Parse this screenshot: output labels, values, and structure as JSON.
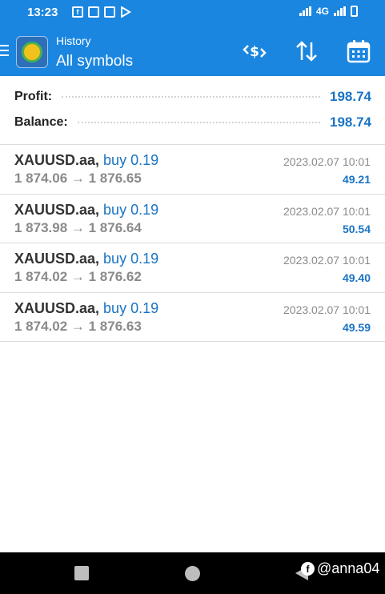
{
  "status_bar": {
    "time": "13:23",
    "network": "4G",
    "left_icons": [
      "facebook-icon",
      "messenger-icon",
      "messenger-icon",
      "play-store-icon"
    ]
  },
  "header": {
    "subtitle": "History",
    "title": "All symbols",
    "actions": [
      "currency-exchange-icon",
      "sort-icon",
      "calendar-icon"
    ]
  },
  "summary": {
    "profit_label": "Profit:",
    "profit_value": "198.74",
    "balance_label": "Balance:",
    "balance_value": "198.74"
  },
  "deals": [
    {
      "symbol": "XAUUSD.aa,",
      "type": "buy 0.19",
      "prices": "1 874.06 → 1 876.65",
      "time": "2023.02.07 10:01",
      "profit": "49.21"
    },
    {
      "symbol": "XAUUSD.aa,",
      "type": "buy 0.19",
      "prices": "1 873.98 → 1 876.64",
      "time": "2023.02.07 10:01",
      "profit": "50.54"
    },
    {
      "symbol": "XAUUSD.aa,",
      "type": "buy 0.19",
      "prices": "1 874.02 → 1 876.62",
      "time": "2023.02.07 10:01",
      "profit": "49.40"
    },
    {
      "symbol": "XAUUSD.aa,",
      "type": "buy 0.19",
      "prices": "1 874.02 → 1 876.63",
      "time": "2023.02.07 10:01",
      "profit": "49.59"
    }
  ],
  "watermark": "@anna04",
  "colors": {
    "accent": "#1a86e0",
    "value_blue": "#1a74c4",
    "muted_gray": "#8a8a8a"
  }
}
